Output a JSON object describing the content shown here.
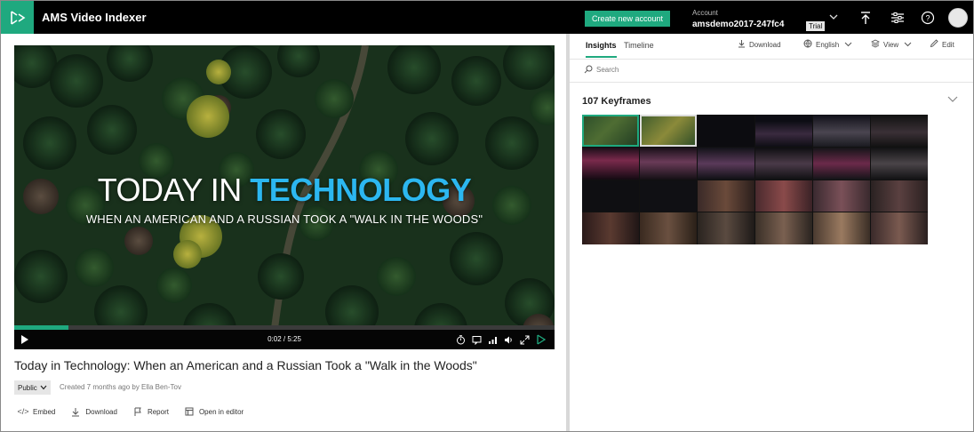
{
  "app": {
    "title": "AMS Video Indexer"
  },
  "header": {
    "create_account_label": "Create new account",
    "account_label": "Account",
    "account_name": "amsdemo2017-247fc4",
    "trial_badge": "Trial"
  },
  "video": {
    "overlay_title_part1": "TODAY IN ",
    "overlay_title_part2": "TECHNOLOGY",
    "overlay_subtitle": "WHEN AN AMERICAN AND A RUSSIAN TOOK A \"WALK IN THE WOODS\"",
    "time_display": "0:02 / 5:25",
    "progress": 0.1,
    "title": "Today in Technology: When an American and a Russian Took a \"Walk in the Woods\"",
    "privacy": "Public",
    "created": "Created 7 months ago by Ella Ben-Tov"
  },
  "actions": {
    "embed": "Embed",
    "download": "Download",
    "report": "Report",
    "open_editor": "Open in editor"
  },
  "insights": {
    "tab_insights": "Insights",
    "tab_timeline": "Timeline",
    "download": "Download",
    "language": "English",
    "view": "View",
    "edit": "Edit",
    "search_placeholder": "Search",
    "keyframes_title": "107 Keyframes"
  },
  "colors": {
    "accent": "#1fa97f",
    "topbar": "#000000",
    "overlay_highlight": "#2cb7f0"
  }
}
